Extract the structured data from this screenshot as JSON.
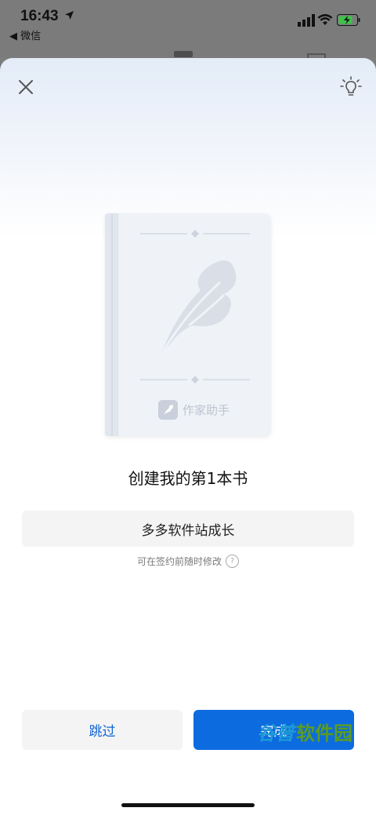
{
  "status_bar": {
    "time": "16:43",
    "back_label": "◀ 微信"
  },
  "book_cover": {
    "brand_label": "作家助手"
  },
  "headline": "创建我的第1本书",
  "book_name_field": {
    "value": "多多软件站成长"
  },
  "hint": "可在签约前随时修改",
  "help_icon_glyph": "?",
  "buttons": {
    "skip": "跳过",
    "done": "完成"
  },
  "watermark": {
    "part1": "谷普",
    "part2": "软件园"
  },
  "colors": {
    "accent": "#0d6be0",
    "link": "#1166d6",
    "field_bg": "#f4f4f4"
  }
}
